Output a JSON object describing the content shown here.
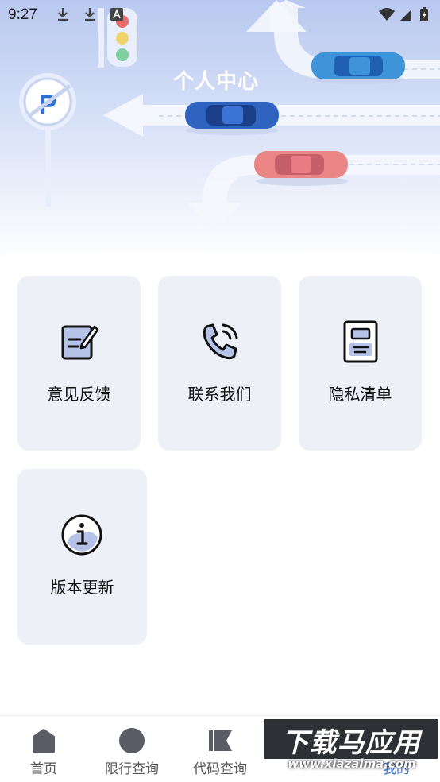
{
  "status_bar": {
    "time": "9:27"
  },
  "header": {
    "title": "个人中心"
  },
  "menu": {
    "items": [
      {
        "label": "意见反馈",
        "icon": "feedback-edit-icon"
      },
      {
        "label": "联系我们",
        "icon": "phone-call-icon"
      },
      {
        "label": "隐私清单",
        "icon": "privacy-document-icon"
      },
      {
        "label": "版本更新",
        "icon": "info-icon"
      }
    ]
  },
  "bottom_nav": {
    "items": [
      {
        "label": "首页",
        "icon": "home-icon"
      },
      {
        "label": "限行查询",
        "icon": "circle-icon"
      },
      {
        "label": "代码查询",
        "icon": "flag-icon"
      },
      {
        "label": "",
        "icon": ""
      },
      {
        "label": "我的",
        "icon": "profile-icon"
      }
    ]
  },
  "watermark": {
    "text": "下载马应用",
    "sub": "www.xiazaima.com"
  },
  "colors": {
    "card_bg": "#eef0f8",
    "accent_blue": "#2f6fd6",
    "icon_fill": "#b6c3e8"
  }
}
